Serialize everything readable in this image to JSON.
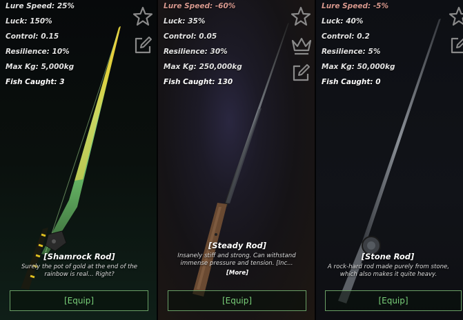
{
  "rods": [
    {
      "stats": [
        {
          "label": "Lure Speed: 25%",
          "negative": false
        },
        {
          "label": "Luck: 150%",
          "negative": false
        },
        {
          "label": "Control: 0.15",
          "negative": false
        },
        {
          "label": "Resilience: 10%",
          "negative": false
        },
        {
          "label": "Max Kg: 5,000kg",
          "negative": false
        },
        {
          "label": "Fish Caught: 3",
          "negative": false
        }
      ],
      "name": "[Shamrock Rod]",
      "description": "Surely the pot of gold at the end of the rainbow is real... Right?",
      "equip_label": "[Equip]",
      "icons": [
        "star-icon",
        "edit-icon"
      ]
    },
    {
      "stats": [
        {
          "label": "Lure Speed: -60%",
          "negative": true
        },
        {
          "label": "Luck: 35%",
          "negative": false
        },
        {
          "label": "Control: 0.05",
          "negative": false
        },
        {
          "label": "Resilience: 30%",
          "negative": false
        },
        {
          "label": "Max Kg: 250,000kg",
          "negative": false
        },
        {
          "label": "Fish Caught: 130",
          "negative": false
        }
      ],
      "name": "[Steady Rod]",
      "description": "Insanely stiff and strong. Can withstand immense pressure and tension. [Inc...",
      "more_label": "[More]",
      "equip_label": "[Equip]",
      "icons": [
        "star-icon",
        "crown-icon",
        "edit-icon"
      ]
    },
    {
      "stats": [
        {
          "label": "Lure Speed: -5%",
          "negative": true
        },
        {
          "label": "Luck: 40%",
          "negative": false
        },
        {
          "label": "Control: 0.2",
          "negative": false
        },
        {
          "label": "Resilience: 5%",
          "negative": false
        },
        {
          "label": "Max Kg: 50,000kg",
          "negative": false
        },
        {
          "label": "Fish Caught: 0",
          "negative": false
        }
      ],
      "name": "[Stone Rod]",
      "description": "A rock-hard rod made purely from stone, which also makes it quite heavy.",
      "equip_label": "[Equip]",
      "icons": [
        "star-icon",
        "edit-icon"
      ]
    }
  ],
  "colors": {
    "stat_text": "#e4e4e4",
    "negative_stat": "#d99a90",
    "equip_text": "#7ad17a",
    "equip_border": "#6aa066",
    "icon": "#8a8a8a"
  }
}
